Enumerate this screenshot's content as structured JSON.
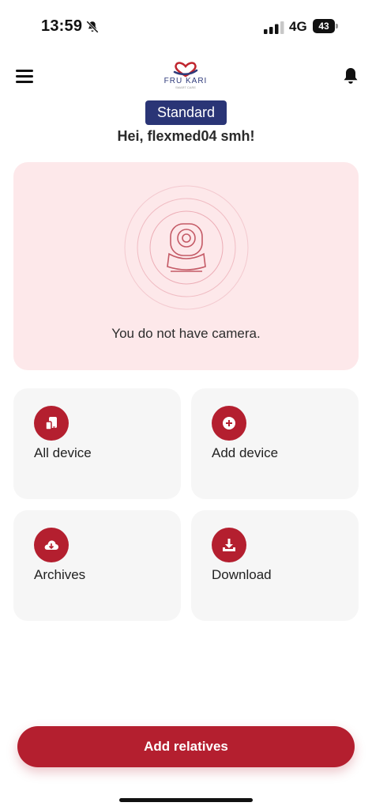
{
  "status_bar": {
    "time": "13:59",
    "network": "4G",
    "battery": "43",
    "icons": [
      "bell-slash-icon",
      "signal-icon",
      "battery-icon"
    ]
  },
  "header": {
    "logo_text": "FRU KARI",
    "logo_sub": "SMART CARE",
    "menu_icon": "hamburger-menu-icon",
    "notification_icon": "bell-icon"
  },
  "plan": {
    "label": "Standard"
  },
  "greeting": "Hei, flexmed04 smh!",
  "camera": {
    "message": "You do not have camera.",
    "icon": "camera-icon"
  },
  "tiles": [
    {
      "label": "All device",
      "icon": "devices-icon"
    },
    {
      "label": "Add device",
      "icon": "plus-circle-icon"
    },
    {
      "label": "Archives",
      "icon": "cloud-download-icon"
    },
    {
      "label": "Download",
      "icon": "download-icon"
    }
  ],
  "actions": {
    "add_relatives": "Add relatives"
  },
  "colors": {
    "primary": "#b41f2f",
    "badge": "#2a3576",
    "camera_card_bg": "#fde8ea",
    "tile_bg": "#f6f6f6"
  }
}
